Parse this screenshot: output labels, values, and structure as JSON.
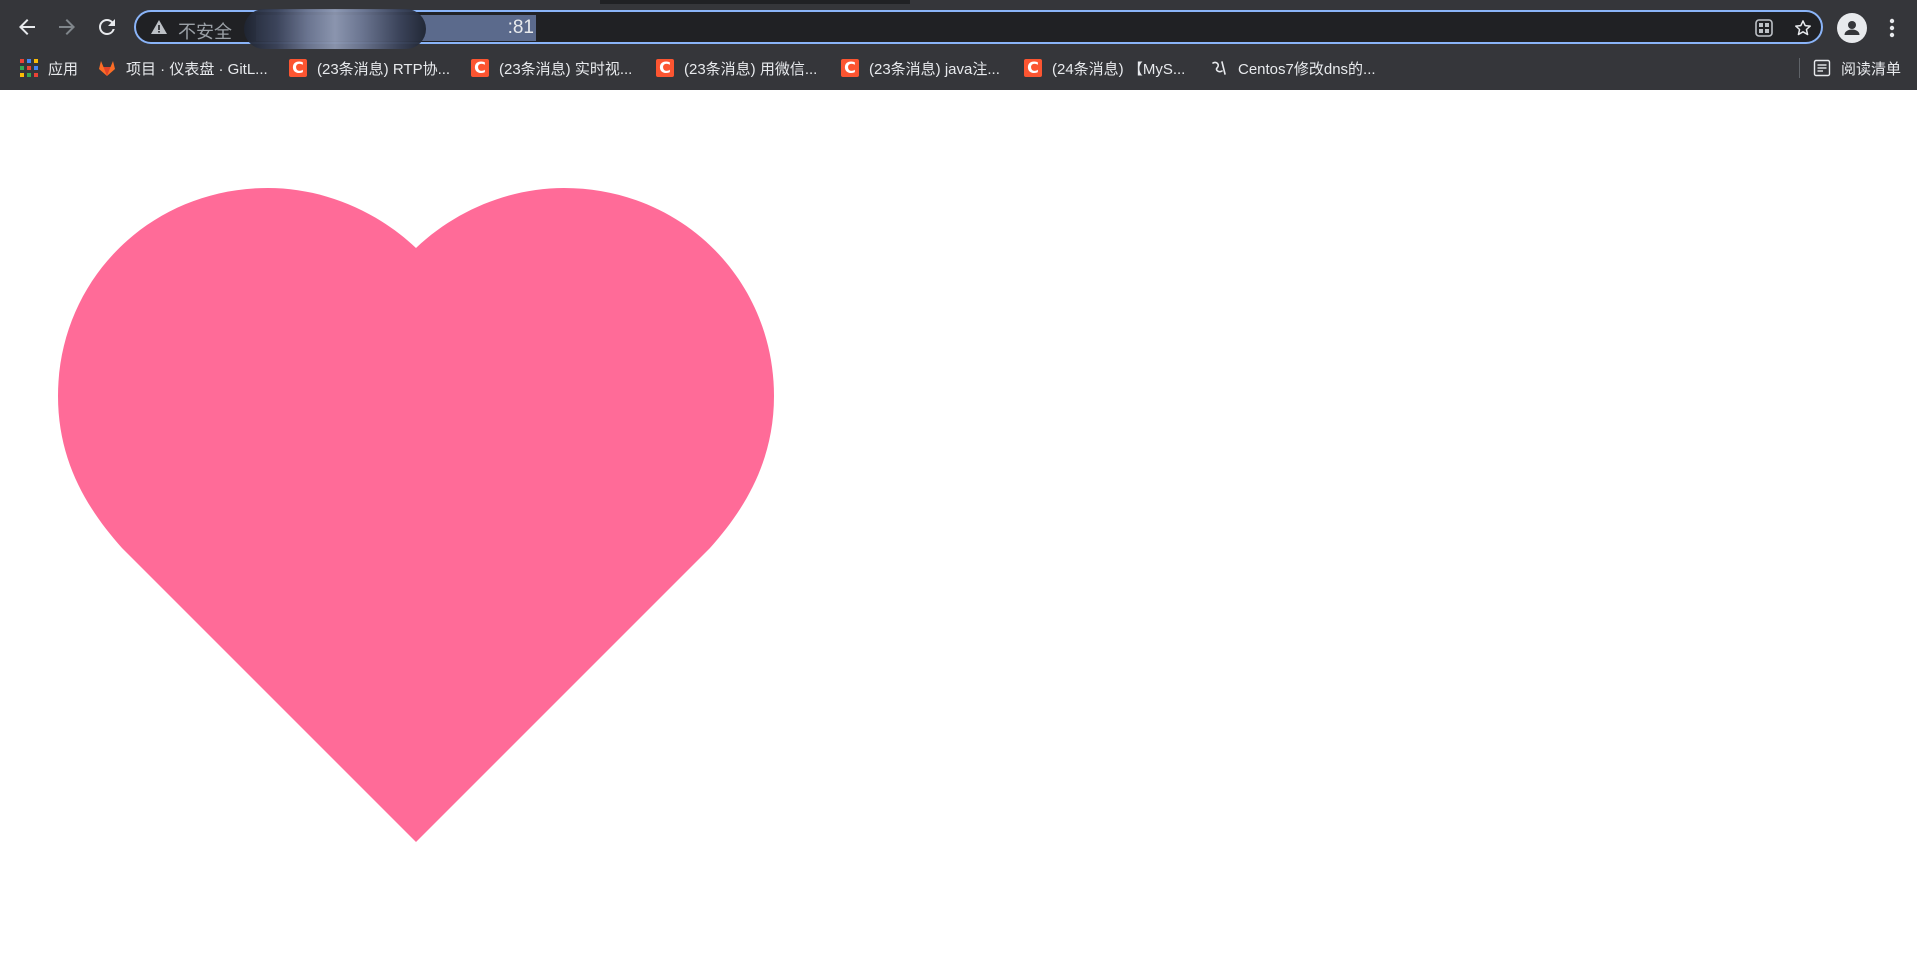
{
  "browser": {
    "omnibox": {
      "security_label": "不安全",
      "url_port": ":81"
    },
    "bookmarks": [
      {
        "label": "应用",
        "icon": "apps-grid-icon"
      },
      {
        "label": "项目 · 仪表盘 · GitL...",
        "icon": "gitlab-icon"
      },
      {
        "label": "(23条消息) RTP协...",
        "icon": "csdn-icon"
      },
      {
        "label": "(23条消息) 实时视...",
        "icon": "csdn-icon"
      },
      {
        "label": "(23条消息) 用微信...",
        "icon": "csdn-icon"
      },
      {
        "label": "(23条消息) java注...",
        "icon": "csdn-icon"
      },
      {
        "label": "(24条消息) 【MyS...",
        "icon": "csdn-icon"
      },
      {
        "label": "Centos7修改dns的...",
        "icon": "site-icon"
      }
    ],
    "reading_list": {
      "label": "阅读清单",
      "icon": "reading-list-icon"
    },
    "csdn_icon_letter": "C"
  },
  "page": {
    "heart_color": "#ff6b98",
    "heart_icon": "heart-shape"
  }
}
